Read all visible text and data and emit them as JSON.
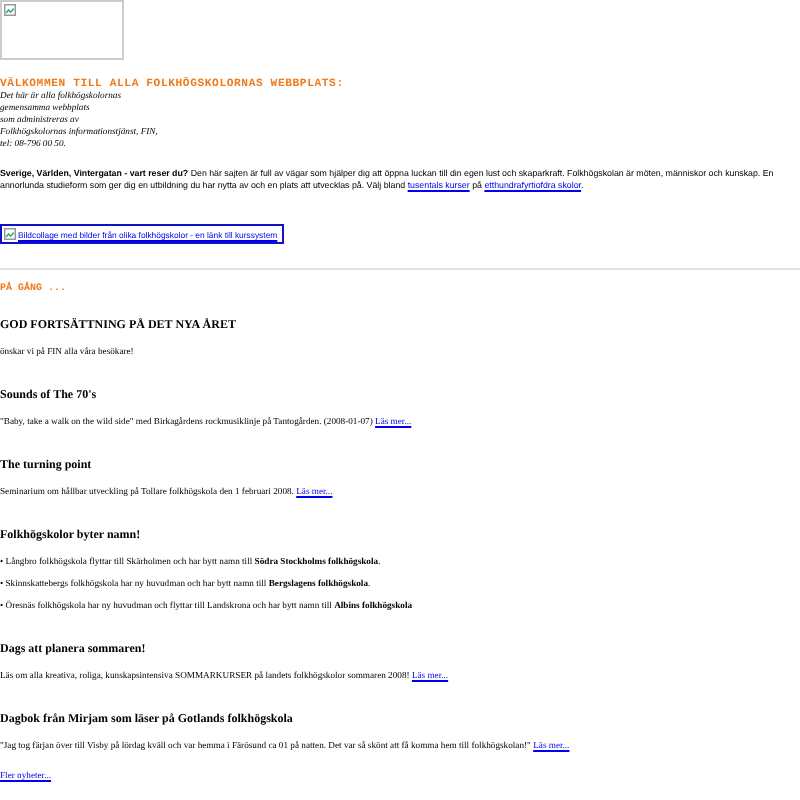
{
  "header": {
    "logo": {
      "kind": "broken-image"
    },
    "welcome": "VÄLKOMMEN TILL ALLA FOLKHÖGSKOLORNAS WEBBPLATS:",
    "intro_lines": [
      "Det här är alla folkhögskolornas",
      "gemensamma webbplats",
      "som administreras av",
      "Folkhögskolornas informationstjänst, FIN,",
      "tel: 08-796 00 50."
    ]
  },
  "lead": {
    "bold": "Sverige, Världen, Vintergatan - vart reser du?",
    "text": "Den här sajten är full av vägar som hjälper dig att öppna luckan till din egen lust och skaparkraft. Folkhögskolan är möten, människor och kunskap. En annorlunda studieform som ger dig en utbildning du har nytta av och en plats att utvecklas på. Välj bland",
    "link1": "tusentals kurser",
    "middle": "på",
    "link2": "etthundrafyrtiofdra skolor",
    "end": "."
  },
  "banner_link": "Bildcollage med bilder från olika folkhögskolor - en länk till kurssystem",
  "section_title": "PÅ GÅNG ...",
  "news": [
    {
      "title": "GOD FORTSÄTTNING PÅ DET NYA ÅRET",
      "paragraphs": [
        "önskar vi på FIN alla våra besökare!"
      ]
    },
    {
      "title": "Sounds of The 70's",
      "paragraphs": [
        "\"Baby, take a walk on the wild side\" med Birkagårdens rockmusiklinje på Tantogården. (2008-01-07)"
      ],
      "more": "Läs mer..."
    },
    {
      "title": "The turning point",
      "paragraphs": [
        "Seminarium om hållbar utveckling på Tollare folkhögskola den 1 februari 2008."
      ],
      "more": "Läs mer..."
    },
    {
      "title": "Folkhögskolor byter namn!",
      "paragraphs": [
        "• Långbro folkhögskola flyttar till Skärholmen och har bytt namn till **Södra Stockholms folkhögskola**.",
        "• Skinnskattebergs folkhögskola har ny huvudman och har bytt namn till **Bergslagens folkhögskola**.",
        "• Öresnäs folkhögskola har ny huvudman och flyttar till Landskrona och har bytt namn till **Albins folkhögskola**"
      ]
    },
    {
      "title": "Dags att planera sommaren!",
      "paragraphs": [
        "Läs om alla kreativa, roliga, kunskapsintensiva SOMMARKURSER på landets folkhögskolor sommaren 2008!"
      ],
      "more": "Läs mer..."
    },
    {
      "title": "Dagbok från Mirjam som läser på Gotlands folkhögskola",
      "paragraphs": [
        "\"Jag tog färjan över till Visby på lördag kväll och var hemma i Färösund ca 01 på natten. Det var så skönt att få komma hem till folkhögskolan!\""
      ],
      "more": "Läs mer..."
    }
  ],
  "more_news": "Fler nyheter..."
}
